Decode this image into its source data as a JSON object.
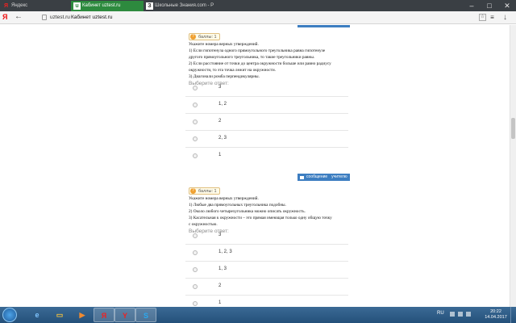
{
  "browser": {
    "tabs": [
      {
        "label": "Яндекс",
        "icon": "Я"
      },
      {
        "label": "Кабинет uztest.ru",
        "icon": "u"
      },
      {
        "label": "Школьные Знания.com - Р",
        "icon": "З"
      }
    ],
    "window_controls": [
      "–",
      "□",
      "✕"
    ],
    "address": {
      "y_button": "Я",
      "back": "←",
      "domain": "uztest.ru",
      "page_title": "Кабинет uztest.ru"
    },
    "right_buttons": [
      "☆",
      "≡",
      "↓"
    ]
  },
  "questions": [
    {
      "badge": "баллы: 1",
      "text_lines": [
        "Укажите номера верных утверждений.",
        "1) Если гипотенуза одного прямоугольного треугольника равна гипотенузе",
        "другого прямоугольного треугольника, то такие треугольники равны.",
        "2) Если расстояние от точки до центра окружности больше или равно радиусу",
        "окружности, то эта точка лежит на окружности.",
        "3) Диагонали ромба перпендикулярны."
      ],
      "choose_label": "Выберите ответ:",
      "answers": [
        "3",
        "1, 2",
        "2",
        "2, 3",
        "1"
      ]
    },
    {
      "badge": "баллы: 1",
      "message_button": {
        "label1": "сообщение",
        "label2": "учителю"
      },
      "text_lines": [
        "Укажите номера верных утверждений.",
        "1) Любые два прямоугольных треугольника подобны.",
        "2) Около любого четырехугольника можно описать окружность.",
        "3) Касательная к окружности – это прямая имеющая только одну общую точку",
        "с окружностью."
      ],
      "choose_label": "Выберите ответ:",
      "answers": [
        "3",
        "1, 2, 3",
        "1, 3",
        "2",
        "1"
      ]
    }
  ],
  "taskbar": {
    "apps": [
      "e",
      "▭",
      "▶",
      "Я",
      "Y",
      "S"
    ],
    "language": "RU",
    "time": "20:22",
    "date": "14.04.2017"
  },
  "colors": {
    "accent_blue": "#3d7ec1",
    "tab_active": "#2d8a3e",
    "coin": "#f0a030"
  }
}
